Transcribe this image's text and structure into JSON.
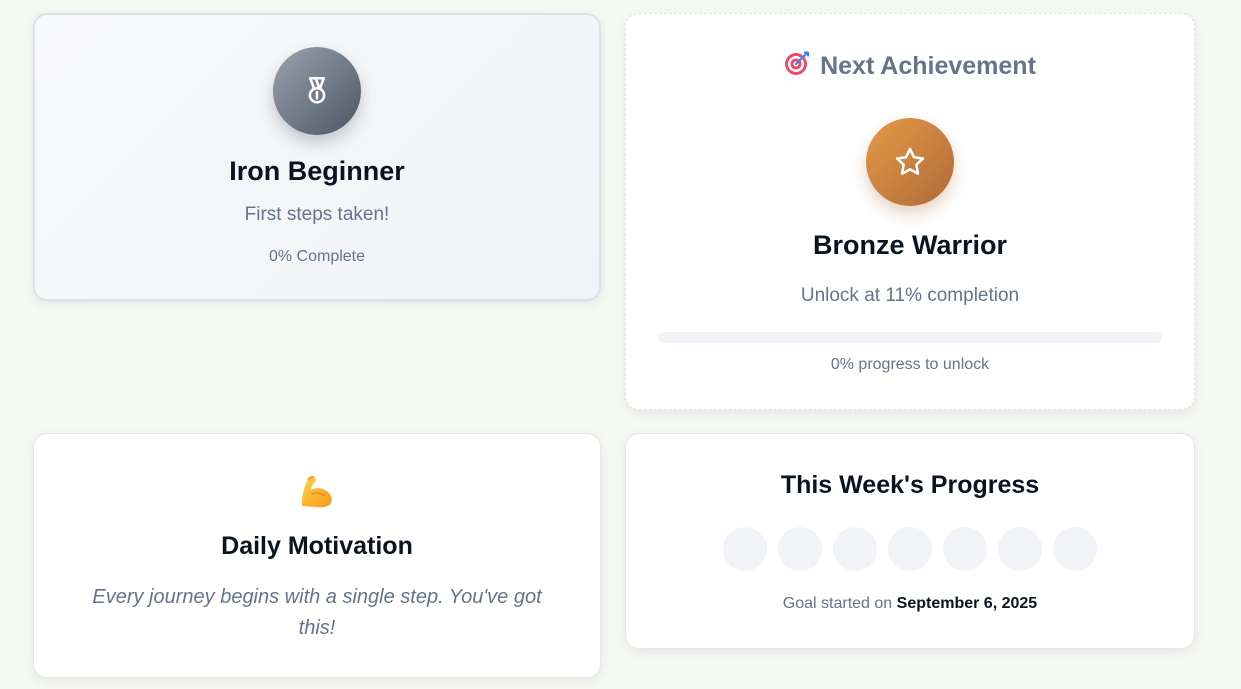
{
  "current_badge": {
    "icon": "medal-icon",
    "title": "Iron Beginner",
    "subtitle": "First steps taken!",
    "completion": "0% Complete"
  },
  "next_achievement": {
    "header_icon": "target-icon",
    "header": "Next Achievement",
    "icon": "star-icon",
    "title": "Bronze Warrior",
    "unlock_text": "Unlock at 11% completion",
    "progress_value": 0,
    "progress_text": "0% progress to unlock"
  },
  "motivation": {
    "icon": "flexed-biceps-icon",
    "title": "Daily Motivation",
    "quote": "Every journey begins with a single step. You've got this!"
  },
  "week_progress": {
    "title": "This Week's Progress",
    "days_completed": [
      false,
      false,
      false,
      false,
      false,
      false,
      false
    ],
    "goal_prefix": "Goal started on",
    "goal_date": "September 6, 2025"
  },
  "colors": {
    "iron": "#6b7280",
    "bronze": "#cd7f32",
    "muted_text": "#64748b",
    "heading_text": "#0b1220"
  }
}
